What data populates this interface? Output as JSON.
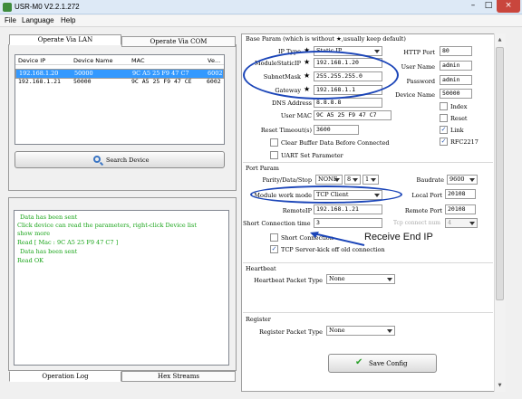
{
  "window": {
    "title": "USR-M0 V2.2.1.272",
    "min_glyph": "–",
    "max_glyph": "□",
    "close_glyph": "×"
  },
  "menu": [
    {
      "label": "File"
    },
    {
      "label": "Language"
    },
    {
      "label": "Help"
    }
  ],
  "left_tabs": {
    "lan": "Operate Via LAN",
    "com": "Operate Via COM"
  },
  "device_table": {
    "headers": [
      "Device IP",
      "Device Name",
      "MAC",
      "Ve..."
    ],
    "rows": [
      {
        "ip": "192.168.1.20",
        "name": "50000",
        "mac": "9C A5 25 F9 47 C7",
        "ver": "6002"
      },
      {
        "ip": "192.168.1.21",
        "name": "50000",
        "mac": "9C A5 25 F9 47 CE",
        "ver": "6002"
      }
    ]
  },
  "search_button": "Search Device",
  "log": {
    "lines": [
      "Data has been sent",
      "Click device can read the parameters, right-click Device list show more",
      "Read [ Mac : 9C A5 25 F9 47 C7 ]",
      "Data has been sent",
      "Read OK"
    ]
  },
  "bottom_tabs": {
    "operation_log": "Operation Log",
    "hex_streams": "Hex Streams"
  },
  "base_param": {
    "section": "Base Param (which is without ★,usually keep default)",
    "ip_type_label": "IP Type",
    "ip_type_value": "Static IP",
    "static_ip_label": "ModuleStaticIP",
    "static_ip_value": "192.168.1.20",
    "subnet_label": "SubnetMask",
    "subnet_value": "255.255.255.0",
    "gateway_label": "Gateway",
    "gateway_value": "192.168.1.1",
    "dns_label": "DNS Address",
    "dns_value": "8.8.8.8",
    "mac_label": "User MAC",
    "mac_value": "9C A5 25 F9 47 C7",
    "reset_timeout_label": "Reset Timeout(s)",
    "reset_timeout_value": "3600",
    "clear_buffer_label": "Clear Buffer Data Before Connected",
    "uart_label": "UART Set Parameter",
    "http_port_label": "HTTP Port",
    "http_port_value": "80",
    "user_name_label": "User Name",
    "user_name_value": "admin",
    "password_label": "Password",
    "password_value": "admin",
    "device_name_label": "Device Name",
    "device_name_value": "50000",
    "index_label": "Index",
    "reset_label": "Reset",
    "link_label": "Link",
    "rfc_label": "RFC2217",
    "star": "★"
  },
  "port_param": {
    "section": "Port Param",
    "pds_label": "Parity/Data/Stop",
    "parity": "NONE",
    "data": "8",
    "stop": "1",
    "baudrate_label": "Baudrate",
    "baudrate_value": "9600",
    "mode_label": "Module work mode",
    "mode_value": "TCP Client",
    "local_port_label": "Local Port",
    "local_port_value": "20108",
    "remote_ip_label": "RemoteIP",
    "remote_ip_value": "192.168.1.21",
    "remote_port_label": "Remote Port",
    "remote_port_value": "20108",
    "short_time_label": "Short Connection time",
    "short_time_value": "3",
    "tcp_num_label": "Tcp connect num",
    "tcp_num_value": "4",
    "short_conn_label": "Short Connection",
    "kickoff_label": "TCP Server-kick off old connection"
  },
  "heartbeat": {
    "section": "Heartbeat",
    "type_label": "Heartbeat Packet Type",
    "type_value": "None"
  },
  "register": {
    "section": "Register",
    "type_label": "Register Packet Type",
    "type_value": "None"
  },
  "save_button": "Save Config",
  "annotation": "Receive End IP",
  "colors": {
    "selection": "#3399ff",
    "log_text": "#18a418",
    "annotation": "#1b45b8",
    "close_button": "#c9463d"
  }
}
